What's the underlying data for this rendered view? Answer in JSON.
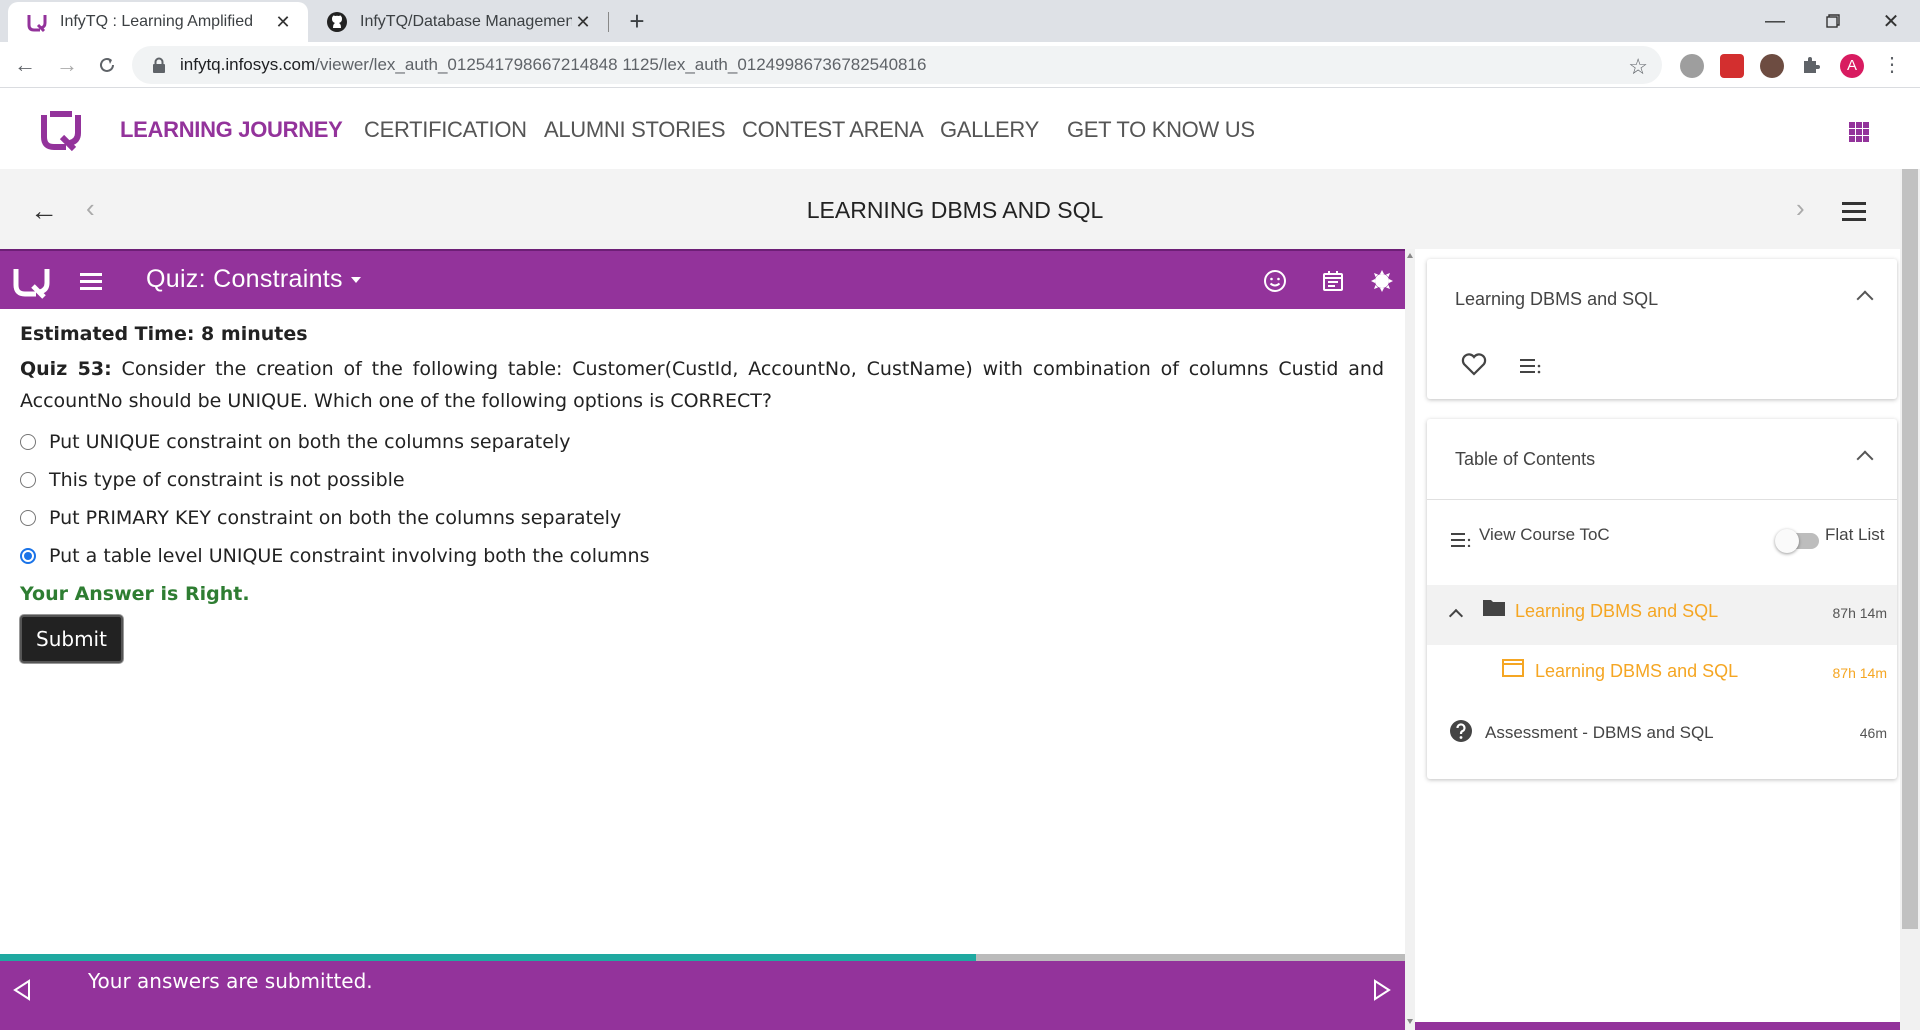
{
  "browser": {
    "tabs": [
      {
        "title": "InfyTQ : Learning Amplified",
        "active": true
      },
      {
        "title": "InfyTQ/Database Management Sy",
        "active": false
      }
    ],
    "address": {
      "host": "infytq.infosys.com",
      "path": "/viewer/lex_auth_012541798667214848 1125/lex_auth_01249986736782540816"
    }
  },
  "site": {
    "nav": [
      {
        "label": "LEARNING JOURNEY",
        "active": true
      },
      {
        "label": "CERTIFICATION"
      },
      {
        "label": "ALUMNI STORIES"
      },
      {
        "label": "CONTEST ARENA"
      },
      {
        "label": "GALLERY"
      },
      {
        "label": "GET TO KNOW US"
      }
    ],
    "brand_color": "#93339b"
  },
  "course": {
    "title": "LEARNING DBMS AND SQL"
  },
  "quiz": {
    "header_title": "Quiz: Constraints",
    "estimated_time": "Estimated Time: 8 minutes",
    "question_number": "Quiz 53:",
    "question_text": " Consider the creation of the following table: Customer(CustId, AccountNo, CustName) with combination of columns Custid and AccountNo should be UNIQUE. Which one of the following options is CORRECT?",
    "options": [
      {
        "label": "Put UNIQUE constraint on both the columns separately",
        "selected": false
      },
      {
        "label": "This type of constraint is not possible",
        "selected": false
      },
      {
        "label": "Put PRIMARY KEY constraint on both the columns separately",
        "selected": false
      },
      {
        "label": "Put a table level UNIQUE constraint involving both the columns",
        "selected": true
      }
    ],
    "result": "Your Answer is Right.",
    "submit_label": "Submit",
    "progress_fraction": 0.695,
    "footer_text": "Your answers are submitted."
  },
  "sidebar": {
    "course_card_title": "Learning DBMS and SQL",
    "toc_card_title": "Table of Contents",
    "view_toc_label": "View Course ToC",
    "flat_list_label": "Flat List",
    "items": [
      {
        "label": "Learning DBMS and SQL",
        "duration": "87h 14m"
      },
      {
        "label": "Learning DBMS and SQL",
        "duration": "87h 14m"
      },
      {
        "label": "Assessment - DBMS and SQL",
        "duration": "46m"
      }
    ],
    "highlight_color": "#f5a623"
  },
  "profile_initial": "A"
}
